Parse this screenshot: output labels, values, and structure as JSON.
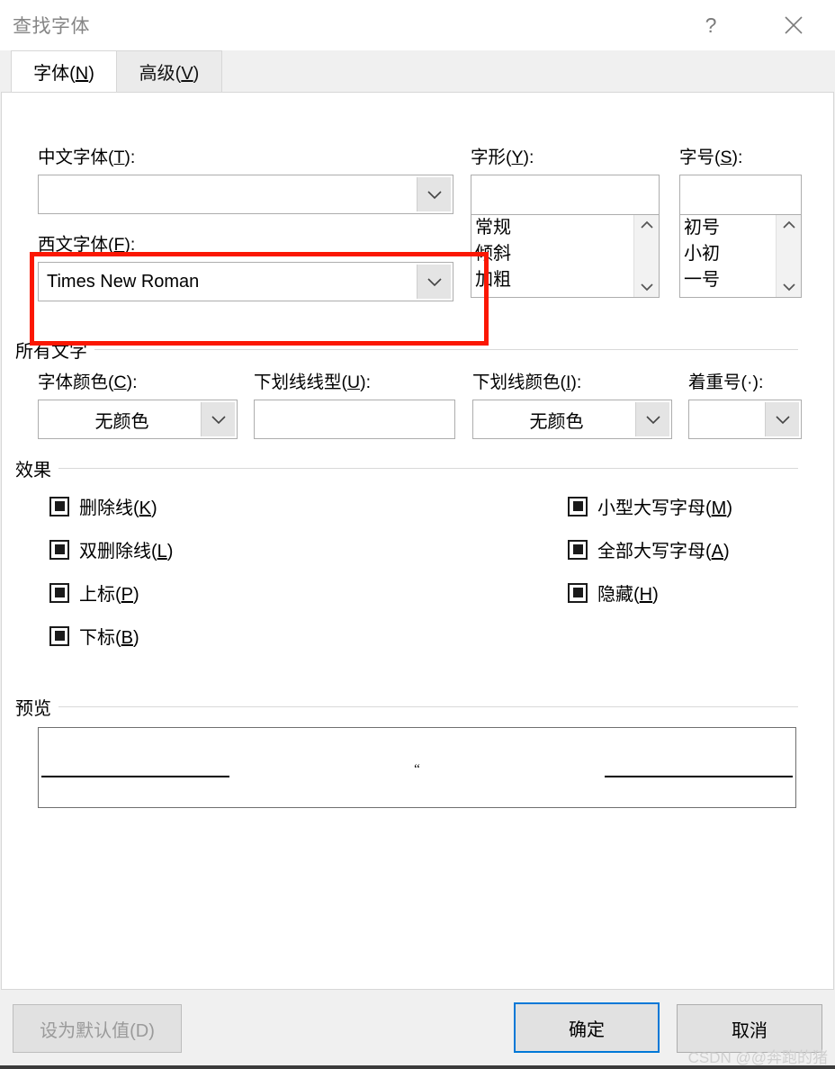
{
  "window": {
    "title": "查找字体",
    "help_icon": "question-mark-icon",
    "close_icon": "close-icon"
  },
  "tabs": [
    {
      "label": "字体(N)",
      "text": "字体(",
      "accel": "N",
      "tail": ")",
      "active": true
    },
    {
      "label": "高级(V)",
      "text": "高级(",
      "accel": "V",
      "tail": ")",
      "active": false
    }
  ],
  "font_section": {
    "chinese_font": {
      "label_pre": "中文字体(",
      "label_accel": "T",
      "label_post": "):",
      "value": "",
      "placeholder": ""
    },
    "western_font": {
      "label_pre": "西文字体(",
      "label_accel": "F",
      "label_post": "):",
      "value": "Times New Roman",
      "placeholder": ""
    },
    "font_style": {
      "label_pre": "字形(",
      "label_accel": "Y",
      "label_post": "):",
      "value": "",
      "options": [
        "常规",
        "倾斜",
        "加粗"
      ]
    },
    "font_size": {
      "label_pre": "字号(",
      "label_accel": "S",
      "label_post": "):",
      "value": "",
      "options": [
        "初号",
        "小初",
        "一号"
      ]
    }
  },
  "all_text": {
    "group_title": "所有文字",
    "font_color": {
      "label_pre": "字体颜色(",
      "label_accel": "C",
      "label_post": "):",
      "value": "无颜色"
    },
    "underline_style": {
      "label_pre": "下划线线型(",
      "label_accel": "U",
      "label_post": "):",
      "value": ""
    },
    "underline_color": {
      "label_pre": "下划线颜色(",
      "label_accel": "I",
      "label_post": "):",
      "value": "无颜色"
    },
    "emphasis_mark": {
      "label_pre": "着重号(·",
      "label_accel": "",
      "label_post": "):",
      "value": ""
    }
  },
  "effects": {
    "group_title": "效果",
    "left_column": [
      {
        "label_pre": "删除线(",
        "accel": "K",
        "label_post": ")",
        "state": "indeterminate"
      },
      {
        "label_pre": "双删除线(",
        "accel": "L",
        "label_post": ")",
        "state": "indeterminate"
      },
      {
        "label_pre": "上标(",
        "accel": "P",
        "label_post": ")",
        "state": "indeterminate"
      },
      {
        "label_pre": "下标(",
        "accel": "B",
        "label_post": ")",
        "state": "indeterminate"
      }
    ],
    "right_column": [
      {
        "label_pre": "小型大写字母(",
        "accel": "M",
        "label_post": ")",
        "state": "indeterminate"
      },
      {
        "label_pre": "全部大写字母(",
        "accel": "A",
        "label_post": ")",
        "state": "indeterminate"
      },
      {
        "label_pre": "隐藏(",
        "accel": "H",
        "label_post": ")",
        "state": "indeterminate"
      }
    ]
  },
  "preview": {
    "group_title": "预览",
    "sample_text": "“"
  },
  "footer": {
    "set_default": {
      "label": "设为默认值(D)",
      "disabled": true
    },
    "ok": {
      "label": "确定",
      "default": true
    },
    "cancel": {
      "label": "取消",
      "default": false
    }
  },
  "watermark": "CSDN @@奔跑的猪",
  "colors": {
    "accent": "#0078d7",
    "highlight_annotation": "#fb1703",
    "dialog_bg": "#f0f0f0",
    "panel_bg": "#ffffff",
    "title_text": "#858585"
  }
}
